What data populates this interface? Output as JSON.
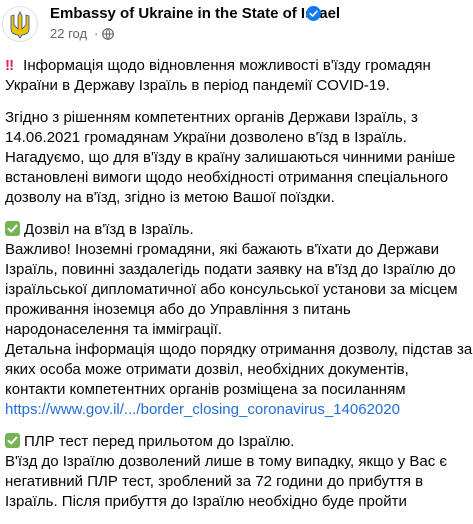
{
  "post": {
    "page_name": "Embassy of Ukraine in the State of Israel",
    "time": "22 год",
    "dot": "·"
  },
  "content": {
    "p1": {
      "emoji": "‼",
      "lines": [
        "Інформація щодо відновлення можливості в'їзду громадян",
        "України в Державу Ізраїль в період пандемії COVID-19."
      ]
    },
    "p2": {
      "lines": [
        "Згідно з рішенням компетентних органів Держави Ізраїль, з",
        "14.06.2021 громадянам України дозволено в'їзд в Ізраїль.",
        "Нагадуємо, що для в'їзду в країну залишаються чинними раніше",
        "встановлені вимоги щодо необхідності отримання спеціального",
        "дозволу на в'їзд, згідно із метою Вашої поїздки."
      ]
    },
    "p3": {
      "lines": [
        "Дозвіл на в'їзд в Ізраїль.",
        "Важливо!   Іноземні громадяни, які бажають в'їхати до Держави",
        "Ізраїль, повинні заздалегідь подати заявку на в'їзд до Ізраїлю до",
        "ізраїльської дипломатичної або консульської установи за місцем",
        "проживання іноземця  або до Управління з питань",
        "народонаселення та імміграції.",
        "Детальна інформація щодо порядку отримання дозволу, підстав за",
        "яких особа може отримати дозвіл, необхідних документів,",
        "контакти компетентних органів розміщена за посиланням"
      ],
      "link": "https://www.gov.il/.../border_closing_coronavirus_14062020"
    },
    "p4": {
      "lines": [
        "ПЛР тест перед прильотом до Ізраїлю.",
        "В'їзд до Ізраїлю дозволений лише в тому випадку, якщо у Вас є",
        "негативний ПЛР тест, зроблений за 72 години до прибуття в",
        "Ізраїль. Після прибуття до Ізраїлю необхідно буде пройти"
      ]
    }
  },
  "colors": {
    "text": "#050505",
    "meta": "#65676b",
    "link": "#216fdb",
    "verified": "#1877f2",
    "check": "#77b255",
    "alert": "#e0245e",
    "flag_blue": "#005bbb",
    "flag_yellow": "#ffd500"
  },
  "icons": {
    "avatar": "ukraine-trident-logo",
    "verified": "verified-badge-icon",
    "privacy": "globe-icon",
    "alert": "double-exclamation-emoji",
    "check": "check-mark-button-emoji"
  }
}
